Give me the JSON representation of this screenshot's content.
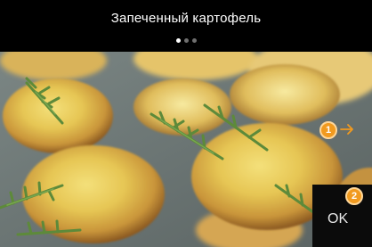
{
  "header": {
    "title": "Запеченный картофель",
    "pager": {
      "count": 3,
      "active": 1
    }
  },
  "hints": {
    "next": {
      "badge": "1",
      "icon": "arrow-right-icon"
    },
    "ok": {
      "badge": "2",
      "label": "OK"
    }
  },
  "colors": {
    "header_bg": "#000000",
    "badge": "#f19a1f",
    "badge_ring": "#ffd79a",
    "ok_panel_bg": "#0b0b0b",
    "text": "#ffffff"
  }
}
